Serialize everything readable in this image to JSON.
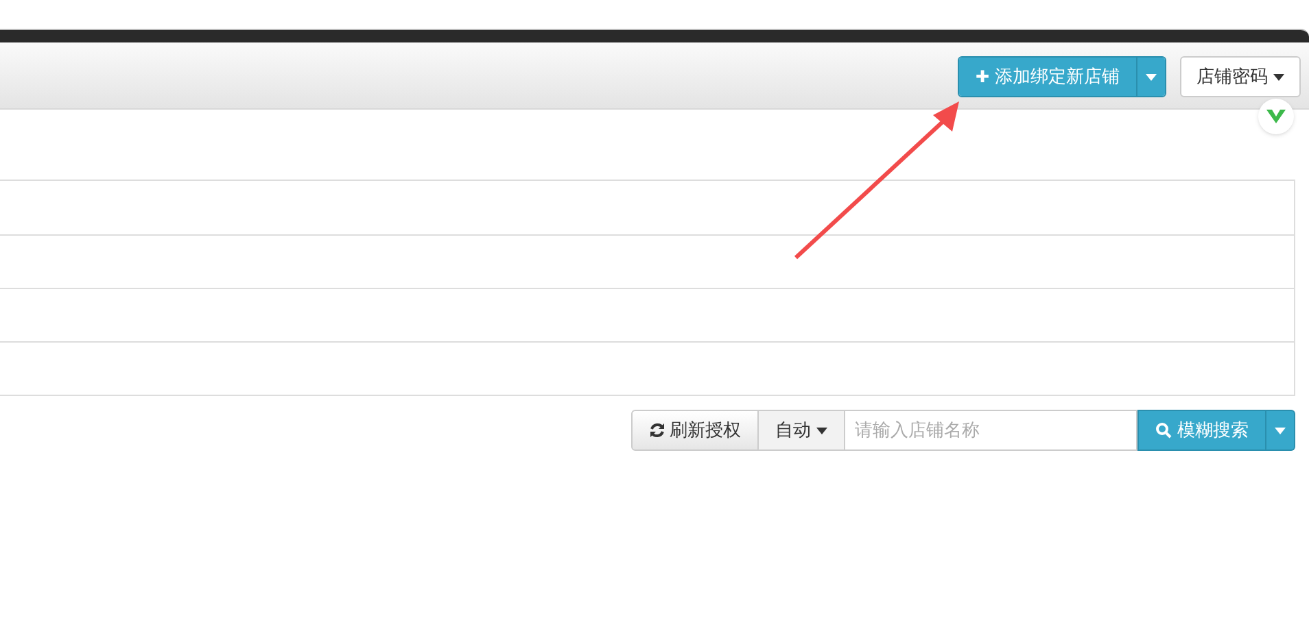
{
  "header": {
    "add_button": {
      "label": "添加绑定新店铺",
      "icon": "✚"
    },
    "password_button": {
      "label": "店铺密码"
    }
  },
  "toolbar": {
    "refresh_button": {
      "label": "刷新授权"
    },
    "mode_button": {
      "label": "自动"
    },
    "search": {
      "placeholder": "请输入店铺名称"
    },
    "search_button": {
      "label": "模糊搜索"
    }
  }
}
